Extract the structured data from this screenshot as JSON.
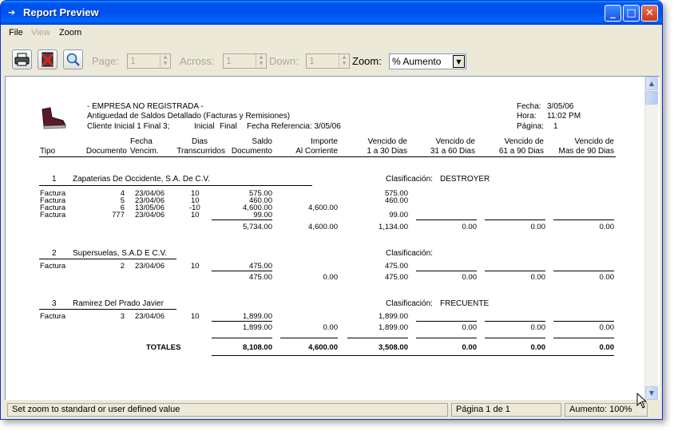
{
  "window": {
    "title": "Report Preview",
    "icon": "arrow-icon"
  },
  "menu": {
    "file": "File",
    "view": "View",
    "zoom": "Zoom"
  },
  "toolbar": {
    "page_label": "Page:",
    "page_value": "1",
    "across_label": "Across:",
    "across_value": "1",
    "down_label": "Down:",
    "down_value": "1",
    "zoom_label": "Zoom:",
    "zoom_value": "% Aumento"
  },
  "report": {
    "company": "- EMPRESA NO REGISTRADA -",
    "report_title": "Antiguedad de Saldos Detallado (Facturas y Remisiones)",
    "filter_cliente": "Cliente Inicial 1 Final 3;",
    "filter_inicial": "Inicial",
    "filter_final": "Final",
    "fecha_referencia": "Fecha Referencia:  3/05/06",
    "fecha_label": "Fecha:",
    "fecha_value": "3/05/06",
    "hora_label": "Hora:",
    "hora_value": "11:02 PM",
    "pagina_label": "Página:",
    "pagina_value": "1",
    "columns": {
      "tipo": "Tipo",
      "documento": "Documento",
      "fecha_1": "Fecha",
      "fecha_2": "Vencim.",
      "dias_1": "Dias",
      "dias_2": "Transcurridos",
      "saldo_1": "Saldo",
      "saldo_2": "Documento",
      "importe_1": "Importe",
      "importe_2": "Al Corriente",
      "v1_1": "Vencido de",
      "v1_2": "1 a 30 Dias",
      "v2_1": "Vencido de",
      "v2_2": "31 a 60 Dias",
      "v3_1": "Vencido de",
      "v3_2": "61 a 90 Dias",
      "v4_1": "Vencido de",
      "v4_2": "Mas de 90 Dias"
    },
    "clients": [
      {
        "num": "1",
        "name": "Zapaterias De Occidente, S.A. De C.V.",
        "clasif_label": "Clasificación:",
        "clasif": "DESTROYER",
        "rows": [
          {
            "tipo": "Factura",
            "doc": "4",
            "fecha": "23/04/06",
            "dias": "10",
            "saldo": "575.00",
            "corr": "",
            "v1": "575.00"
          },
          {
            "tipo": "Factura",
            "doc": "5",
            "fecha": "23/04/06",
            "dias": "10",
            "saldo": "460.00",
            "corr": "",
            "v1": "460.00"
          },
          {
            "tipo": "Factura",
            "doc": "6",
            "fecha": "13/05/06",
            "dias": "-10",
            "saldo": "4,600.00",
            "corr": "4,600.00",
            "v1": ""
          },
          {
            "tipo": "Factura",
            "doc": "777",
            "fecha": "23/04/06",
            "dias": "10",
            "saldo": "99.00",
            "corr": "",
            "v1": "99.00"
          }
        ],
        "totals": {
          "saldo": "5,734.00",
          "corr": "4,600.00",
          "v1": "1,134.00",
          "v2": "0.00",
          "v3": "0.00",
          "v4": "0.00"
        }
      },
      {
        "num": "2",
        "name": "Supersuelas, S.A.D E C.V.",
        "clasif_label": "Clasificación:",
        "clasif": "",
        "rows": [
          {
            "tipo": "Factura",
            "doc": "2",
            "fecha": "23/04/06",
            "dias": "10",
            "saldo": "475.00",
            "corr": "",
            "v1": "475.00"
          }
        ],
        "totals": {
          "saldo": "475.00",
          "corr": "0.00",
          "v1": "475.00",
          "v2": "0.00",
          "v3": "0.00",
          "v4": "0.00"
        }
      },
      {
        "num": "3",
        "name": "Ramirez Del Prado Javier",
        "clasif_label": "Clasificación:",
        "clasif": "FRECUENTE",
        "rows": [
          {
            "tipo": "Factura",
            "doc": "3",
            "fecha": "23/04/06",
            "dias": "10",
            "saldo": "1,899.00",
            "corr": "",
            "v1": "1,899.00"
          }
        ],
        "totals": {
          "saldo": "1,899.00",
          "corr": "0.00",
          "v1": "1,899.00",
          "v2": "0.00",
          "v3": "0.00",
          "v4": "0.00"
        }
      }
    ],
    "grand_total": {
      "label": "TOTALES",
      "saldo": "8,108.00",
      "corr": "4,600.00",
      "v1": "3,508.00",
      "v2": "0.00",
      "v3": "0.00",
      "v4": "0.00"
    }
  },
  "status": {
    "message": "Set zoom to standard or user defined value",
    "page": "Página 1 de 1",
    "zoom": "Aumento: 100%"
  }
}
